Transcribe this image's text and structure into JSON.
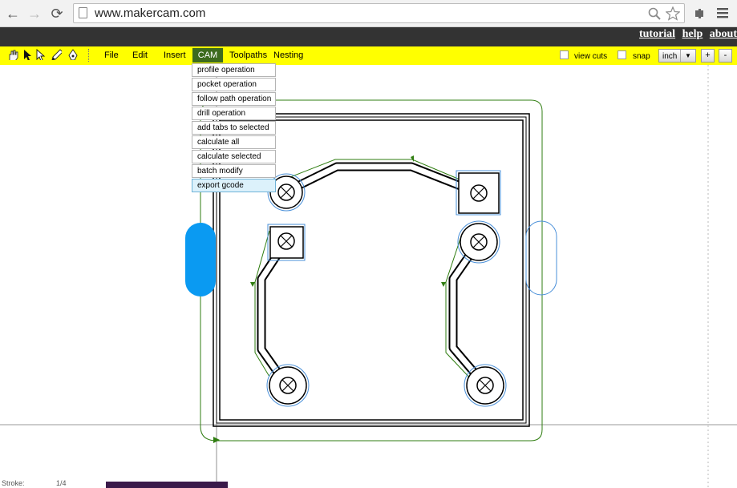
{
  "browser": {
    "url": "www.makercam.com",
    "back_icon": "←",
    "forward_icon": "→",
    "reload_icon": "⟳"
  },
  "header_links": [
    "tutorial",
    "help",
    "about"
  ],
  "toolbar": {
    "menus": [
      "File",
      "Edit",
      "Insert",
      "CAM",
      "Toolpaths",
      "Nesting"
    ],
    "active_menu": "CAM",
    "view_cuts_label": "view cuts",
    "snap_label": "snap",
    "unit_value": "inch",
    "zoom_in": "+",
    "zoom_out": "-"
  },
  "cam_menu": {
    "items": [
      "profile operation",
      "pocket operation",
      "follow path operation",
      "drill operation",
      "add tabs to selected",
      "calculate all",
      "calculate selected",
      "batch modify",
      "export gcode"
    ],
    "hovered": "export gcode"
  },
  "status": {
    "label": "Stroke:",
    "value": "1/4"
  },
  "colors": {
    "toolbar": "#ffff00",
    "top_strip": "#333333",
    "active_menu": "#3d6b1e",
    "toolpath": "#2f7d10",
    "selected_tab": "#0a9af2",
    "outline_blue": "#4a90d9"
  }
}
